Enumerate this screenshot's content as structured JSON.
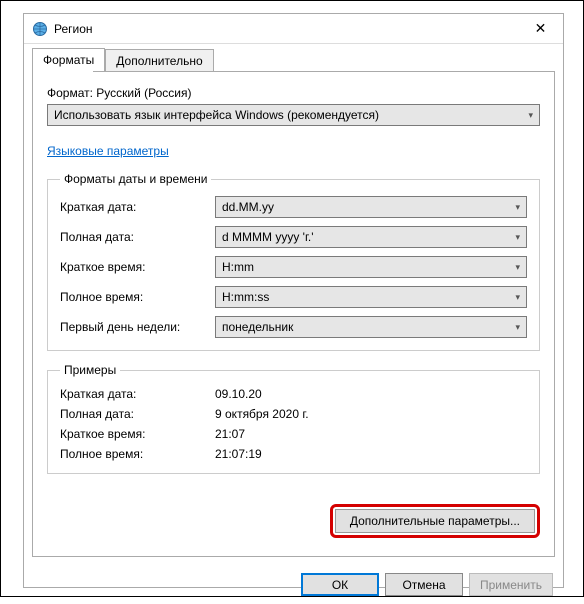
{
  "window": {
    "title": "Регион",
    "close": "✕"
  },
  "tabs": {
    "formats": "Форматы",
    "advanced": "Дополнительно"
  },
  "format_section": {
    "label": "Формат: Русский (Россия)",
    "selected": "Использовать язык интерфейса Windows (рекомендуется)"
  },
  "lang_link": "Языковые параметры",
  "datetime_group": {
    "legend": "Форматы даты и времени",
    "short_date_label": "Краткая дата:",
    "short_date_value": "dd.MM.yy",
    "long_date_label": "Полная дата:",
    "long_date_value": "d MMMM yyyy 'г.'",
    "short_time_label": "Краткое время:",
    "short_time_value": "H:mm",
    "long_time_label": "Полное время:",
    "long_time_value": "H:mm:ss",
    "first_day_label": "Первый день недели:",
    "first_day_value": "понедельник"
  },
  "examples_group": {
    "legend": "Примеры",
    "short_date_label": "Краткая дата:",
    "short_date_value": "09.10.20",
    "long_date_label": "Полная дата:",
    "long_date_value": "9 октября 2020 г.",
    "short_time_label": "Краткое время:",
    "short_time_value": "21:07",
    "long_time_label": "Полное время:",
    "long_time_value": "21:07:19"
  },
  "advanced_button": "Дополнительные параметры...",
  "buttons": {
    "ok": "ОК",
    "cancel": "Отмена",
    "apply": "Применить"
  }
}
